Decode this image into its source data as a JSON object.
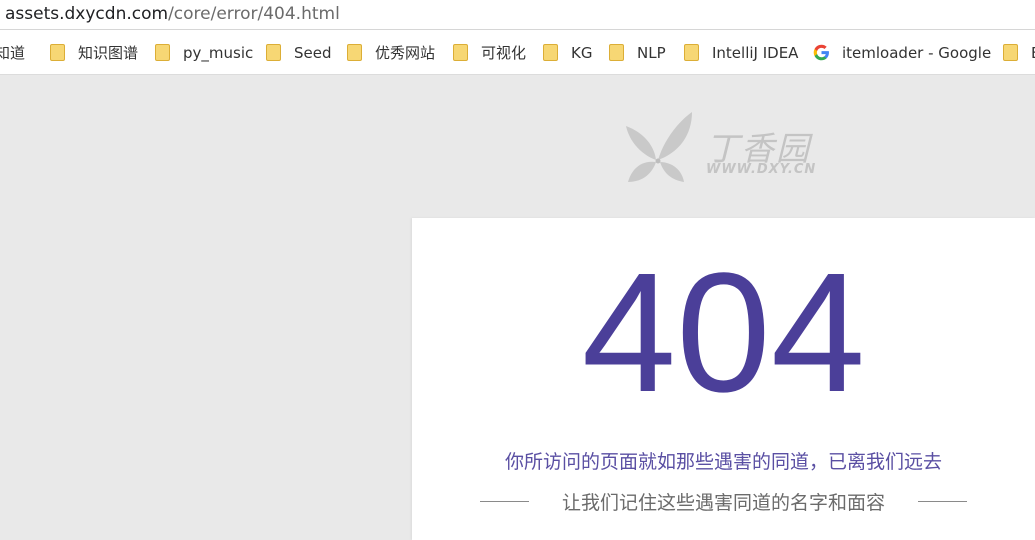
{
  "browser": {
    "url_host": "assets.dxycdn.com",
    "url_path": "/core/error/404.html"
  },
  "bookmarks": [
    {
      "label": "知道",
      "icon": "folder-icon",
      "partial": true
    },
    {
      "label": "知识图谱",
      "icon": "folder-icon"
    },
    {
      "label": "py_music",
      "icon": "folder-icon"
    },
    {
      "label": "Seed",
      "icon": "folder-icon"
    },
    {
      "label": "优秀网站",
      "icon": "folder-icon"
    },
    {
      "label": "可视化",
      "icon": "folder-icon"
    },
    {
      "label": "KG",
      "icon": "folder-icon"
    },
    {
      "label": "NLP",
      "icon": "folder-icon"
    },
    {
      "label": "IntelliJ IDEA",
      "icon": "folder-icon"
    },
    {
      "label": "itemloader - Google",
      "icon": "google-icon",
      "partial": true
    },
    {
      "label": "B",
      "icon": "folder-icon",
      "partial": true
    }
  ],
  "logo": {
    "name_cn": "丁香园",
    "site": "WWW.DXY.CN"
  },
  "error": {
    "code": "404",
    "message": "你所访问的页面就如那些遇害的同道，已离我们远去",
    "submessage": "让我们记住这些遇害同道的名字和面容"
  },
  "colors": {
    "accent": "#4b3f99",
    "message": "#5a4fa3",
    "page_bg": "#e9e9e9",
    "folder": "#f7d774"
  }
}
